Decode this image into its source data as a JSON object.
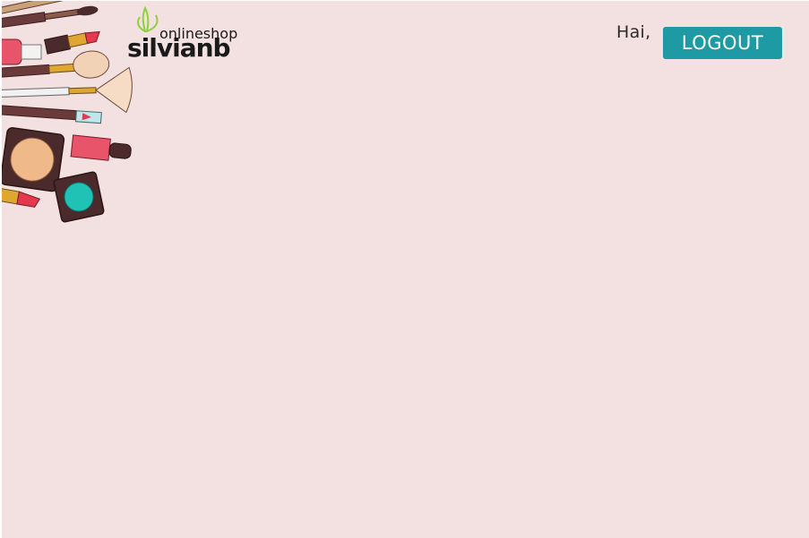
{
  "header": {
    "logo": {
      "top_text": "onlineshop",
      "brand_text": "silvianb"
    },
    "greeting": "Hai,",
    "logout_label": "LOGOUT"
  },
  "colors": {
    "background": "#f3e0e1",
    "logout_button": "#1d9aa3",
    "logo_leaf": "#8fd13a"
  },
  "decoration": {
    "icon": "makeup-illustration"
  }
}
